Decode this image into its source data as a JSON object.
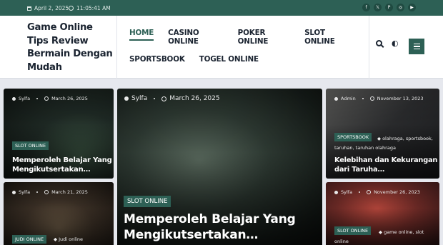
{
  "topbar": {
    "date": "April 2, 2025",
    "time": "11:05:41 AM",
    "social_icons": [
      "facebook-icon",
      "x-icon",
      "pinterest-icon",
      "instagram-icon",
      "youtube-icon"
    ]
  },
  "site": {
    "title": "Game Online Tips Review Bermain Dengan Mudah"
  },
  "nav": {
    "items": [
      {
        "label": "HOME",
        "active": true
      },
      {
        "label": "CASINO ONLINE"
      },
      {
        "label": "POKER ONLINE"
      },
      {
        "label": "SLOT ONLINE"
      },
      {
        "label": "SPORTSBOOK"
      },
      {
        "label": "TOGEL ONLINE"
      }
    ]
  },
  "colors": {
    "accent": "#2d6055",
    "text": "#1b2431",
    "page_bg": "#e6e8ee"
  },
  "posts": {
    "left_top": {
      "author": "Sylfa",
      "date": "March 26, 2025",
      "category": "SLOT ONLINE",
      "title": "Memperoleh Belajar Yang Mengikutsertakan…"
    },
    "left_bottom": {
      "author": "Sylfa",
      "date": "March 21, 2025",
      "category": "JUDI ONLINE",
      "tags": "Judi online"
    },
    "center": {
      "author": "Sylfa",
      "date": "March 26, 2025",
      "category": "SLOT ONLINE",
      "title": "Memperoleh Belajar Yang Mengikutsertakan…"
    },
    "right_top": {
      "author": "Admin",
      "date": "November 13, 2023",
      "category": "SPORTSBOOK",
      "tags": "olahraga, sportsbook, taruhan, taruhan olahraga",
      "title": "Kelebihan dan Kekurangan dari Taruha…"
    },
    "right_bottom": {
      "author": "Sylfa",
      "date": "November 26, 2023",
      "category": "SLOT ONLINE",
      "tags": "game online, slot online"
    }
  }
}
